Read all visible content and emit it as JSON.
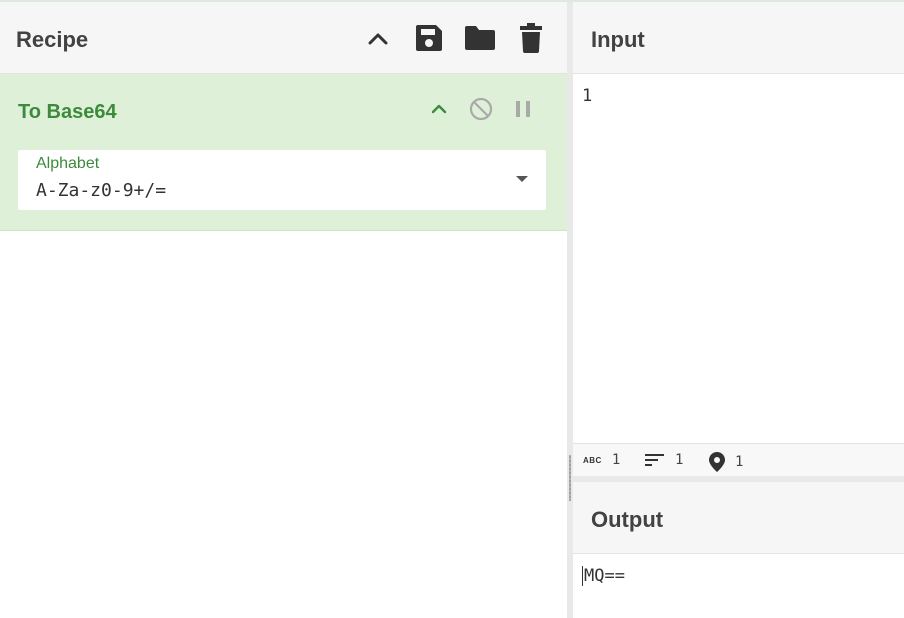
{
  "recipe": {
    "title": "Recipe",
    "header_icons": [
      "chevron-up-icon",
      "save-icon",
      "folder-icon",
      "trash-icon"
    ]
  },
  "operation": {
    "title": "To Base64",
    "icons": [
      "chevron-up-icon",
      "disable-icon",
      "pause-icon"
    ],
    "field": {
      "label": "Alphabet",
      "value": "A-Za-z0-9+/="
    },
    "accent_color": "#3c8b3c",
    "background_color": "#dff0d8"
  },
  "input": {
    "title": "Input",
    "value": "1"
  },
  "status": {
    "length": "1",
    "lines": "1",
    "position": "1"
  },
  "output": {
    "title": "Output",
    "value": "MQ=="
  }
}
